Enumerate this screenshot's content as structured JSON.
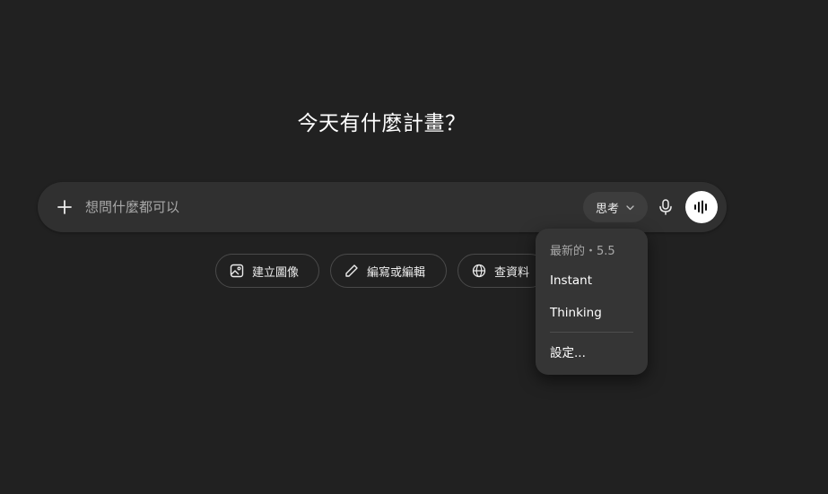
{
  "main": {
    "headline": "今天有什麼計畫？"
  },
  "composer": {
    "placeholder": "想問什麼都可以",
    "mode_label": "思考",
    "icons": {
      "add": "plus-icon",
      "mode_dropdown": "chevron-down-icon",
      "mic": "microphone-icon",
      "voice": "voice-waveform-icon"
    }
  },
  "suggestions": [
    {
      "label": "建立圖像",
      "icon": "image-icon"
    },
    {
      "label": "編寫或編輯",
      "icon": "pencil-icon"
    },
    {
      "label": "查資料",
      "icon": "globe-icon"
    }
  ],
  "model_menu": {
    "header": "最新的・5.5",
    "items": [
      "Instant",
      "Thinking"
    ],
    "settings": "設定..."
  },
  "colors": {
    "background": "#212121",
    "composer": "#303030",
    "menu": "#353535",
    "voice_button": "#ffffff"
  }
}
